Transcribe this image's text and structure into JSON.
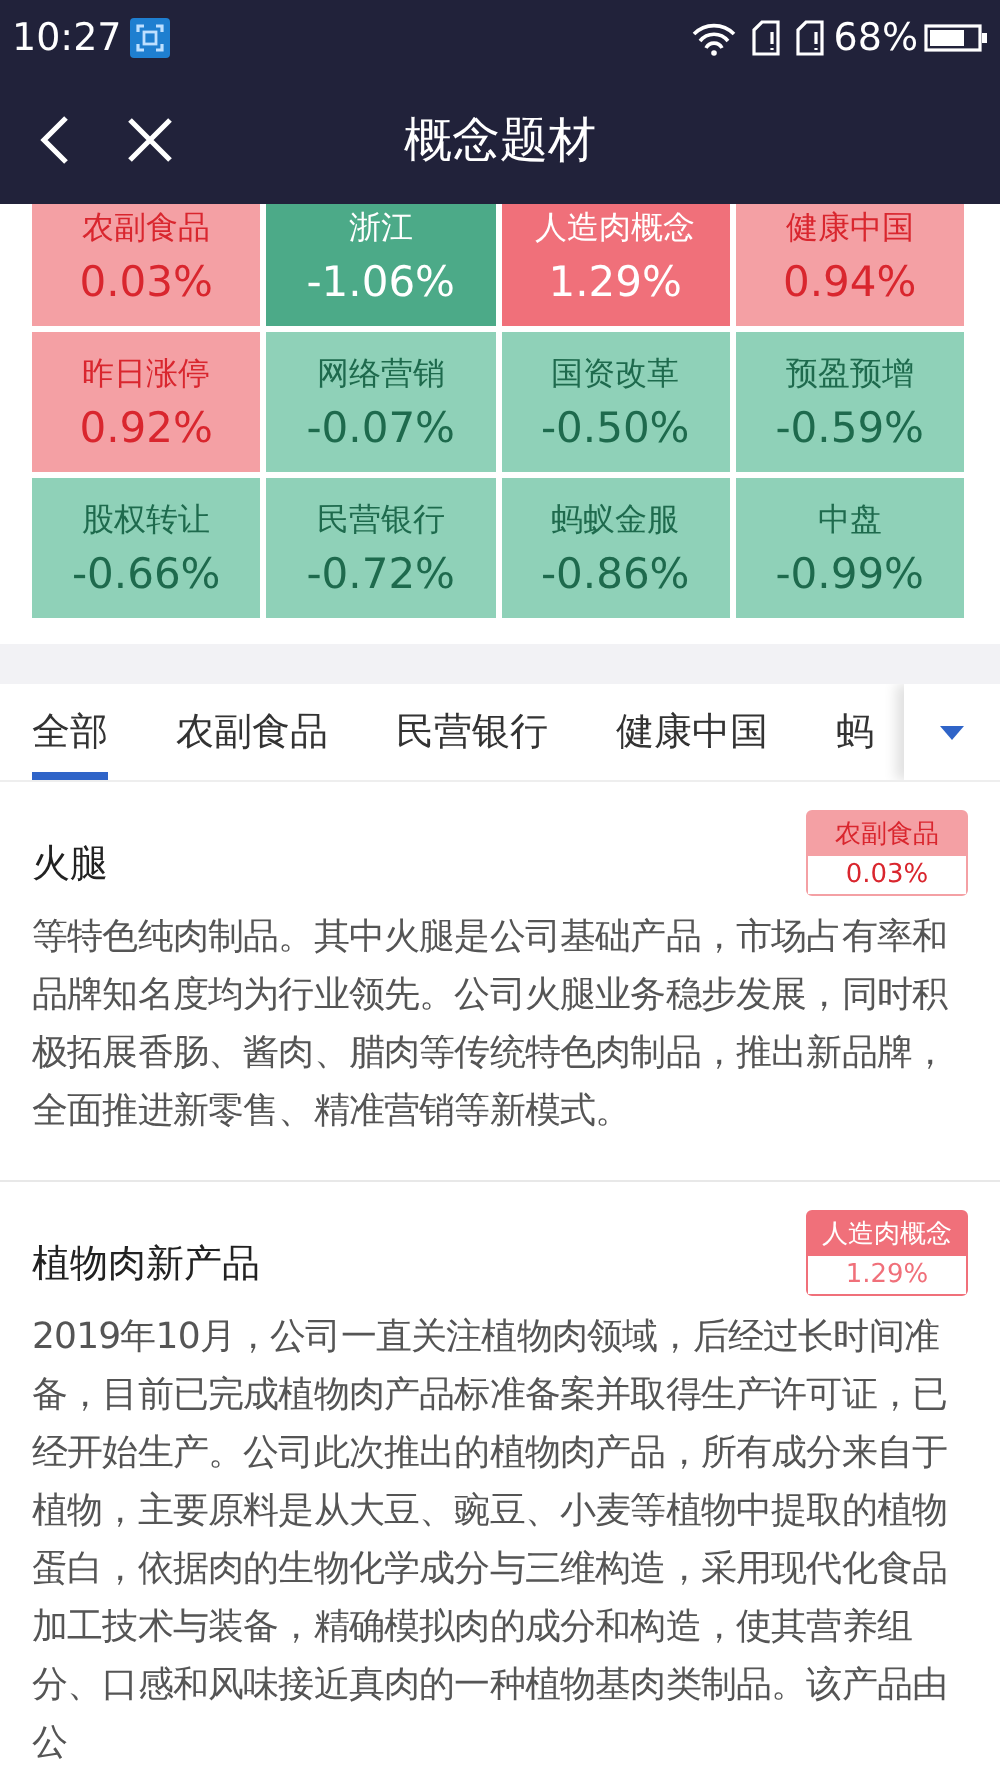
{
  "status_bar": {
    "time": "10:27",
    "battery": "68%"
  },
  "header": {
    "title": "概念题材"
  },
  "tiles": [
    {
      "name": "农副食品",
      "change": "0.03%",
      "color": "#f4a0a4"
    },
    {
      "name": "浙江",
      "change": "-1.06%",
      "color": "#4caa88"
    },
    {
      "name": "人造肉概念",
      "change": "1.29%",
      "color": "#f0707a"
    },
    {
      "name": "健康中国",
      "change": "0.94%",
      "color": "#f4a0a4"
    },
    {
      "name": "昨日涨停",
      "change": "0.92%",
      "color": "#f4a0a4"
    },
    {
      "name": "网络营销",
      "change": "-0.07%",
      "color": "#8fd1b8"
    },
    {
      "name": "国资改革",
      "change": "-0.50%",
      "color": "#8fd1b8"
    },
    {
      "name": "预盈预增",
      "change": "-0.59%",
      "color": "#8fd1b8"
    },
    {
      "name": "股权转让",
      "change": "-0.66%",
      "color": "#8fd1b8"
    },
    {
      "name": "民营银行",
      "change": "-0.72%",
      "color": "#8fd1b8"
    },
    {
      "name": "蚂蚁金服",
      "change": "-0.86%",
      "color": "#8fd1b8"
    },
    {
      "name": "中盘",
      "change": "-0.99%",
      "color": "#8fd1b8"
    }
  ],
  "tabs": [
    {
      "label": "全部",
      "selected": true
    },
    {
      "label": "农副食品",
      "selected": false
    },
    {
      "label": "民营银行",
      "selected": false
    },
    {
      "label": "健康中国",
      "selected": false
    },
    {
      "label": "蚂",
      "selected": false
    }
  ],
  "articles": [
    {
      "title": "火腿",
      "tag": {
        "name": "农副食品",
        "change": "0.03%",
        "color": "#f4a0a4"
      },
      "text": "等特色纯肉制品。其中火腿是公司基础产品，市场占有率和品牌知名度均为行业领先。公司火腿业务稳步发展，同时积极拓展香肠、酱肉、腊肉等传统特色肉制品，推出新品牌，全面推进新零售、精准营销等新模式。"
    },
    {
      "title": "植物肉新产品",
      "tag": {
        "name": "人造肉概念",
        "change": "1.29%",
        "color": "#f0707a"
      },
      "text": "2019年10月，公司一直关注植物肉领域，后经过长时间准备，目前已完成植物肉产品标准备案并取得生产许可证，已经开始生产。公司此次推出的植物肉产品，所有成分来自于植物，主要原料是从大豆、豌豆、小麦等植物中提取的植物蛋白，依据肉的生物化学成分与三维构造，采用现代化食品加工技术与装备，精确模拟肉的成分和构造，使其营养组分、口感和风味接近真肉的一种植物基肉类制品。该产品由公"
    }
  ]
}
